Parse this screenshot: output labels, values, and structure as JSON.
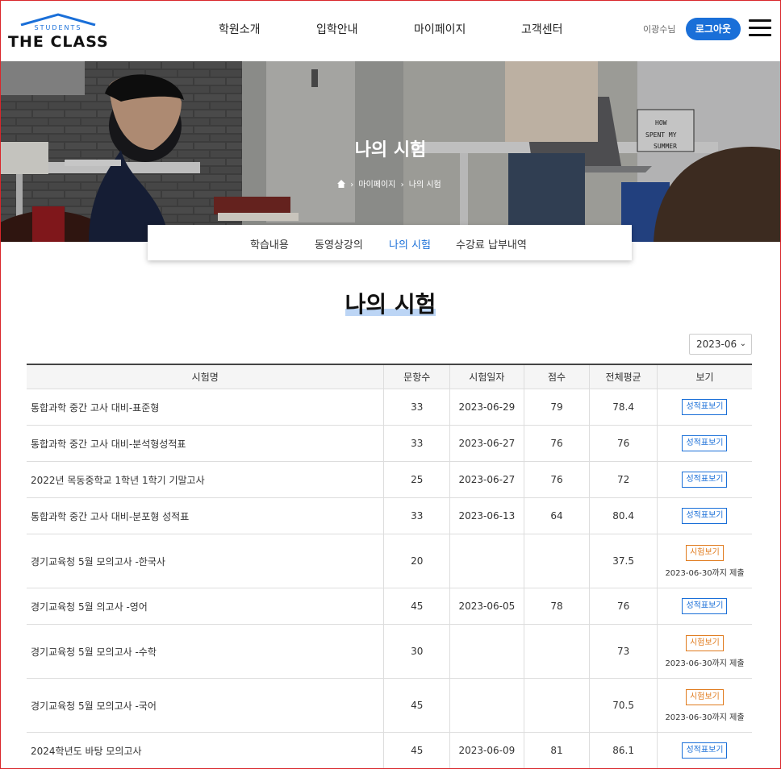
{
  "header": {
    "logo_small": "STUDENTS",
    "logo_brand": "THE CLASS",
    "nav": [
      "학원소개",
      "입학안내",
      "마이페이지",
      "고객센터"
    ],
    "user_name": "이광수님",
    "logout_label": "로그아웃"
  },
  "hero": {
    "title": "나의 시험",
    "breadcrumb": [
      "마이페이지",
      "나의 시험"
    ],
    "lightbox_text": "HOW I SPENT MY SUMMER"
  },
  "subtabs": [
    "학습내용",
    "동영상강의",
    "나의 시험",
    "수강료 납부내역"
  ],
  "active_subtab": "나의 시험",
  "page_title": "나의 시험",
  "month_select": "2023-06",
  "table": {
    "headers": [
      "시험명",
      "문항수",
      "시험일자",
      "점수",
      "전체평균",
      "보기"
    ],
    "rows": [
      {
        "name": "통합과학 중간 고사 대비-표준형",
        "count": "33",
        "date": "2023-06-29",
        "score": "79",
        "avg": "78.4",
        "action": "성적표보기",
        "due": ""
      },
      {
        "name": "통합과학 중간 고사 대비-분석형성적표",
        "count": "33",
        "date": "2023-06-27",
        "score": "76",
        "avg": "76",
        "action": "성적표보기",
        "due": ""
      },
      {
        "name": "2022년 목동중학교 1학년 1학기 기말고사",
        "count": "25",
        "date": "2023-06-27",
        "score": "76",
        "avg": "72",
        "action": "성적표보기",
        "due": ""
      },
      {
        "name": "통합과학 중간 고사 대비-분포형 성적표",
        "count": "33",
        "date": "2023-06-13",
        "score": "64",
        "avg": "80.4",
        "action": "성적표보기",
        "due": ""
      },
      {
        "name": "경기교육청 5월 모의고사 -한국사",
        "count": "20",
        "date": "",
        "score": "",
        "avg": "37.5",
        "action": "시험보기",
        "due": "2023-06-30까지 제출"
      },
      {
        "name": "경기교육청 5월 의고사 -영어",
        "count": "45",
        "date": "2023-06-05",
        "score": "78",
        "avg": "76",
        "action": "성적표보기",
        "due": ""
      },
      {
        "name": "경기교육청 5월 모의고사 -수학",
        "count": "30",
        "date": "",
        "score": "",
        "avg": "73",
        "action": "시험보기",
        "due": "2023-06-30까지 제출"
      },
      {
        "name": "경기교육청 5월 모의고사 -국어",
        "count": "45",
        "date": "",
        "score": "",
        "avg": "70.5",
        "action": "시험보기",
        "due": "2023-06-30까지 제출"
      },
      {
        "name": "2024학년도 바탕 모의고사",
        "count": "45",
        "date": "2023-06-09",
        "score": "81",
        "avg": "86.1",
        "action": "성적표보기",
        "due": ""
      }
    ]
  },
  "colors": {
    "accent": "#1a6fd8",
    "exam_button": "#e07b1e",
    "frame": "#d9262b"
  }
}
